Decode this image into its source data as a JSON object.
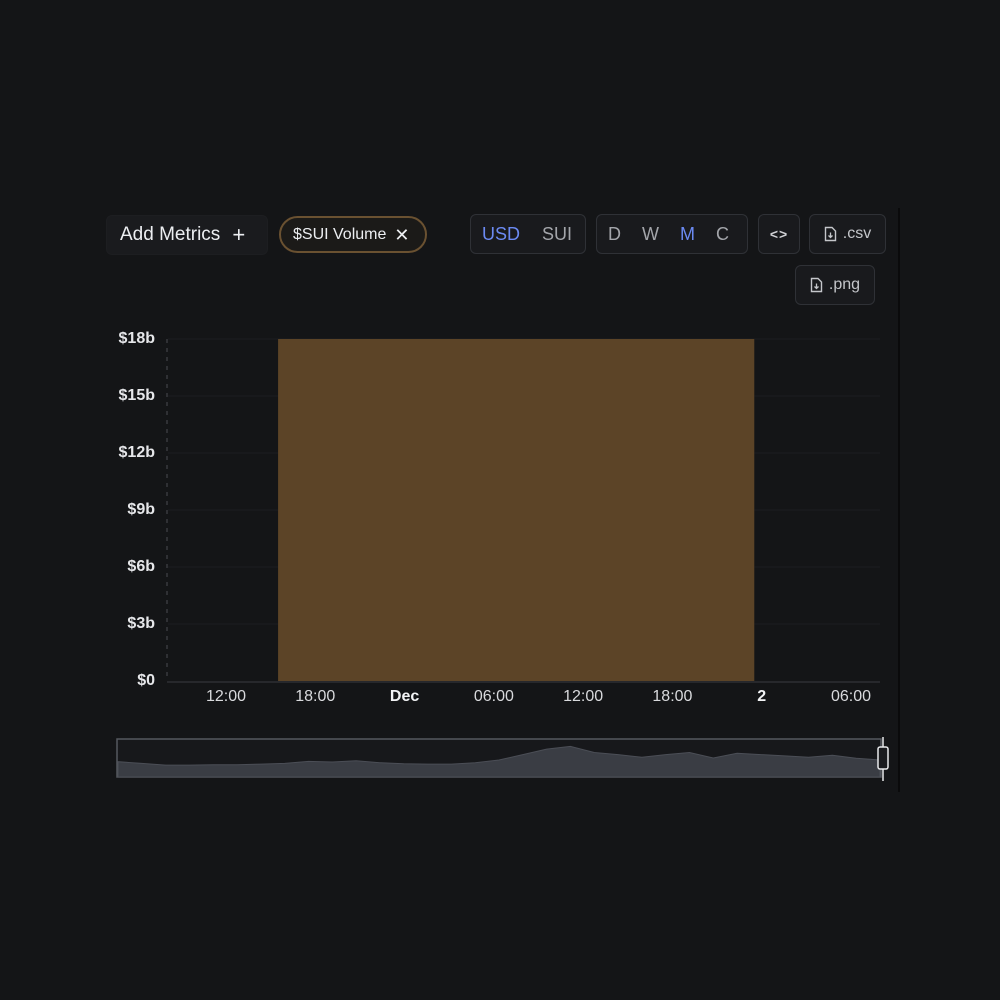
{
  "toolbar": {
    "add_metrics_label": "Add Metrics",
    "add_metrics_icon": "+",
    "metric_chip_label": "$SUI Volume",
    "metric_chip_close": "✕",
    "currency_options": [
      "USD",
      "SUI"
    ],
    "currency_selected": "USD",
    "period_options": [
      "D",
      "W",
      "M",
      "C"
    ],
    "period_selected": "M",
    "embed_label": "<>",
    "csv_label": ".csv",
    "png_label": ".png"
  },
  "colors": {
    "accent": "#6b8af2",
    "bar_fill": "#5c4427",
    "chip_border": "#6a5131",
    "navigator_fill": "#3a3d44"
  },
  "chart_data": {
    "type": "bar",
    "series": [
      {
        "values": [
          18
        ]
      }
    ],
    "x_start": "Nov 30 15:30",
    "x_end": "Dec 1 23:30",
    "ylim": [
      0,
      18
    ],
    "y_unit": "$b",
    "y_tick_labels": [
      "$0",
      "$3b",
      "$6b",
      "$9b",
      "$12b",
      "$15b",
      "$18b"
    ],
    "x_tick_labels": [
      "12:00",
      "18:00",
      "Dec",
      "06:00",
      "12:00",
      "18:00",
      "2",
      "06:00"
    ],
    "x_tick_bold": [
      false,
      false,
      true,
      false,
      false,
      false,
      true,
      false
    ],
    "grid": true,
    "navigator_values": [
      0.45,
      0.4,
      0.35,
      0.35,
      0.36,
      0.36,
      0.38,
      0.4,
      0.46,
      0.44,
      0.48,
      0.42,
      0.39,
      0.38,
      0.38,
      0.42,
      0.5,
      0.66,
      0.82,
      0.9,
      0.72,
      0.66,
      0.58,
      0.66,
      0.72,
      0.56,
      0.7,
      0.66,
      0.62,
      0.58,
      0.64,
      0.55,
      0.5
    ]
  }
}
